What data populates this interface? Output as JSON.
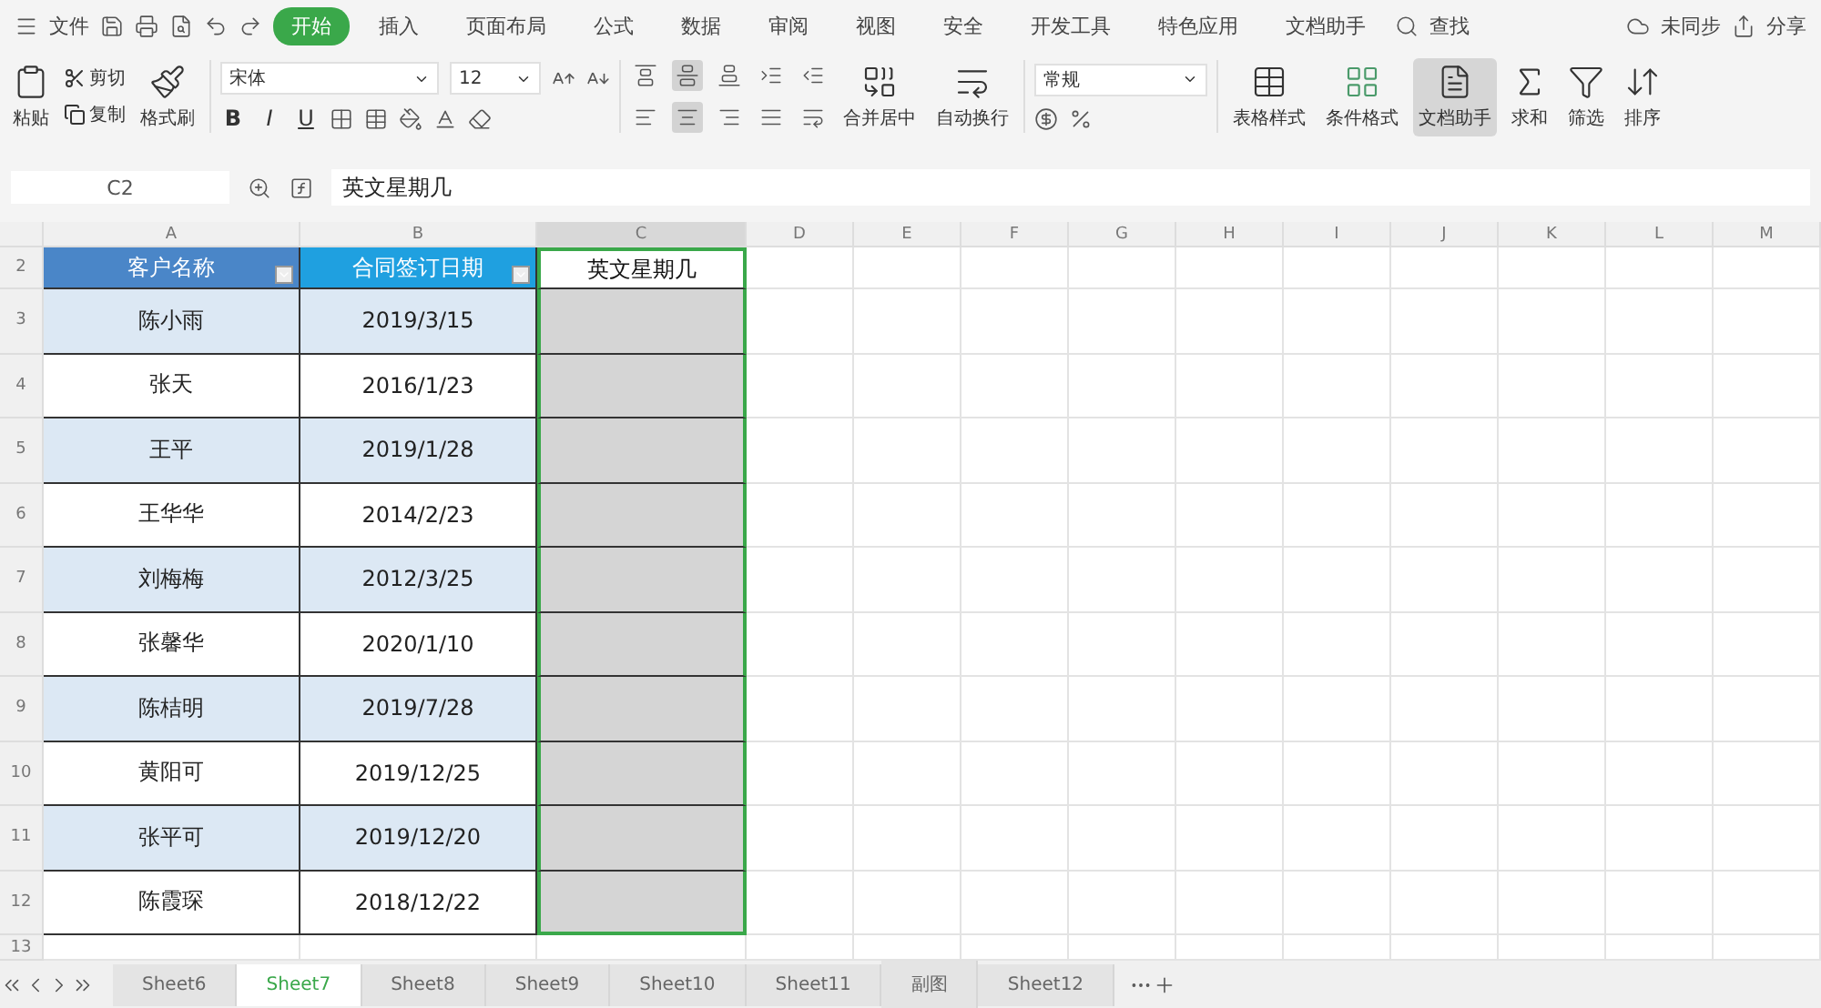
{
  "menu_bar": {
    "file_menu": "文件",
    "tabs": [
      {
        "label": "开始",
        "selected": true
      },
      {
        "label": "插入",
        "selected": false
      },
      {
        "label": "页面布局",
        "selected": false
      },
      {
        "label": "公式",
        "selected": false
      },
      {
        "label": "数据",
        "selected": false
      },
      {
        "label": "审阅",
        "selected": false
      },
      {
        "label": "视图",
        "selected": false
      },
      {
        "label": "安全",
        "selected": false
      },
      {
        "label": "开发工具",
        "selected": false
      },
      {
        "label": "特色应用",
        "selected": false
      },
      {
        "label": "文档助手",
        "selected": false
      }
    ],
    "search": "查找",
    "sync": "未同步",
    "share": "分享"
  },
  "ribbon": {
    "paste": "粘贴",
    "cut": "剪切",
    "copy": "复制",
    "format_painter": "格式刷",
    "font": "宋体",
    "font_size": "12",
    "bold": "B",
    "italic": "I",
    "underline": "U",
    "align_buttons": [
      {
        "selected": false
      },
      {
        "selected": true
      },
      {
        "selected": false
      },
      {
        "selected": false
      },
      {
        "selected": false
      },
      {
        "selected": false
      },
      {
        "selected": true
      },
      {
        "selected": false
      },
      {
        "selected": false
      },
      {
        "selected": false
      }
    ],
    "merge": "合并居中",
    "wrap": "自动换行",
    "number_format": "常规",
    "table_style": "表格样式",
    "conditional_format": "条件格式",
    "doc_helper": {
      "label": "文档助手",
      "selected": true
    },
    "sum": "求和",
    "filter": "筛选",
    "sort": "排序"
  },
  "formula_bar": {
    "cell_ref": "C2",
    "formula": "英文星期几"
  },
  "sheet": {
    "columns": [
      "A",
      "B",
      "C",
      "D",
      "E",
      "F",
      "G",
      "H",
      "I",
      "J",
      "K",
      "L",
      "M"
    ],
    "row_numbers": [
      "2",
      "3",
      "4",
      "5",
      "6",
      "7",
      "8",
      "9",
      "10",
      "11",
      "12",
      "13"
    ],
    "headers": [
      "客户名称",
      "合同签订日期",
      "英文星期几"
    ],
    "rows": [
      [
        "陈小雨",
        "2019/3/15"
      ],
      [
        "张天",
        "2016/1/23"
      ],
      [
        "王平",
        "2019/1/28"
      ],
      [
        "王华华",
        "2014/2/23"
      ],
      [
        "刘梅梅",
        "2012/3/25"
      ],
      [
        "张馨华",
        "2020/1/10"
      ],
      [
        "陈桔明",
        "2019/7/28"
      ],
      [
        "黄阳可",
        "2019/12/25"
      ],
      [
        "张平可",
        "2019/12/20"
      ],
      [
        "陈霞琛",
        "2018/12/22"
      ]
    ]
  },
  "sheet_tabs": [
    {
      "label": "Sheet6",
      "selected": false
    },
    {
      "label": "Sheet7",
      "selected": true
    },
    {
      "label": "Sheet8",
      "selected": false
    },
    {
      "label": "Sheet9",
      "selected": false
    },
    {
      "label": "Sheet10",
      "selected": false
    },
    {
      "label": "Sheet11",
      "selected": false
    },
    {
      "label": "副图",
      "selected": false
    },
    {
      "label": "Sheet12",
      "selected": false
    }
  ]
}
